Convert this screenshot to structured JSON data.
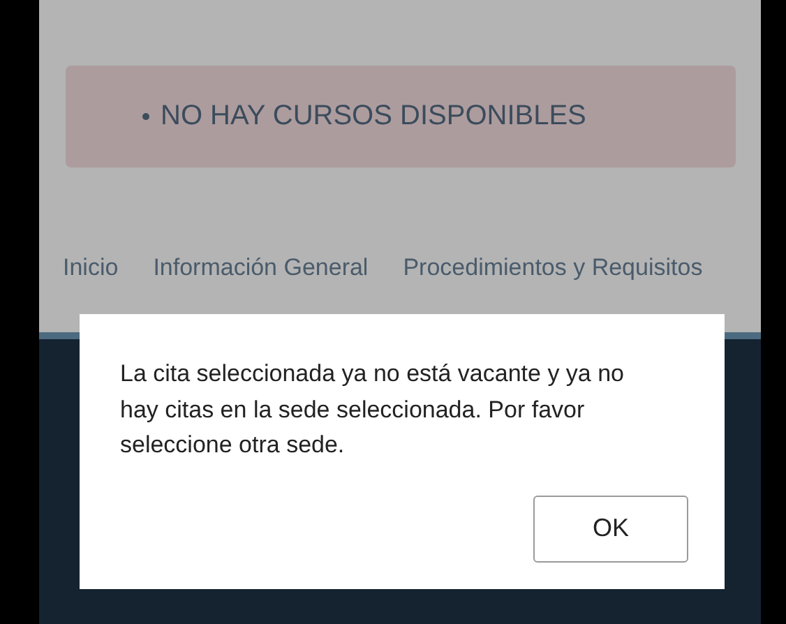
{
  "alert": {
    "items": [
      "NO HAY CURSOS DISPONIBLES"
    ]
  },
  "nav": {
    "links": [
      "Inicio",
      "Información General",
      "Procedimientos y Requisitos"
    ]
  },
  "dialog": {
    "message": "La cita seleccionada ya no está vacante y ya no hay citas en la sede seleccionada. Por favor seleccione otra sede.",
    "buttons": [
      "OK"
    ]
  }
}
